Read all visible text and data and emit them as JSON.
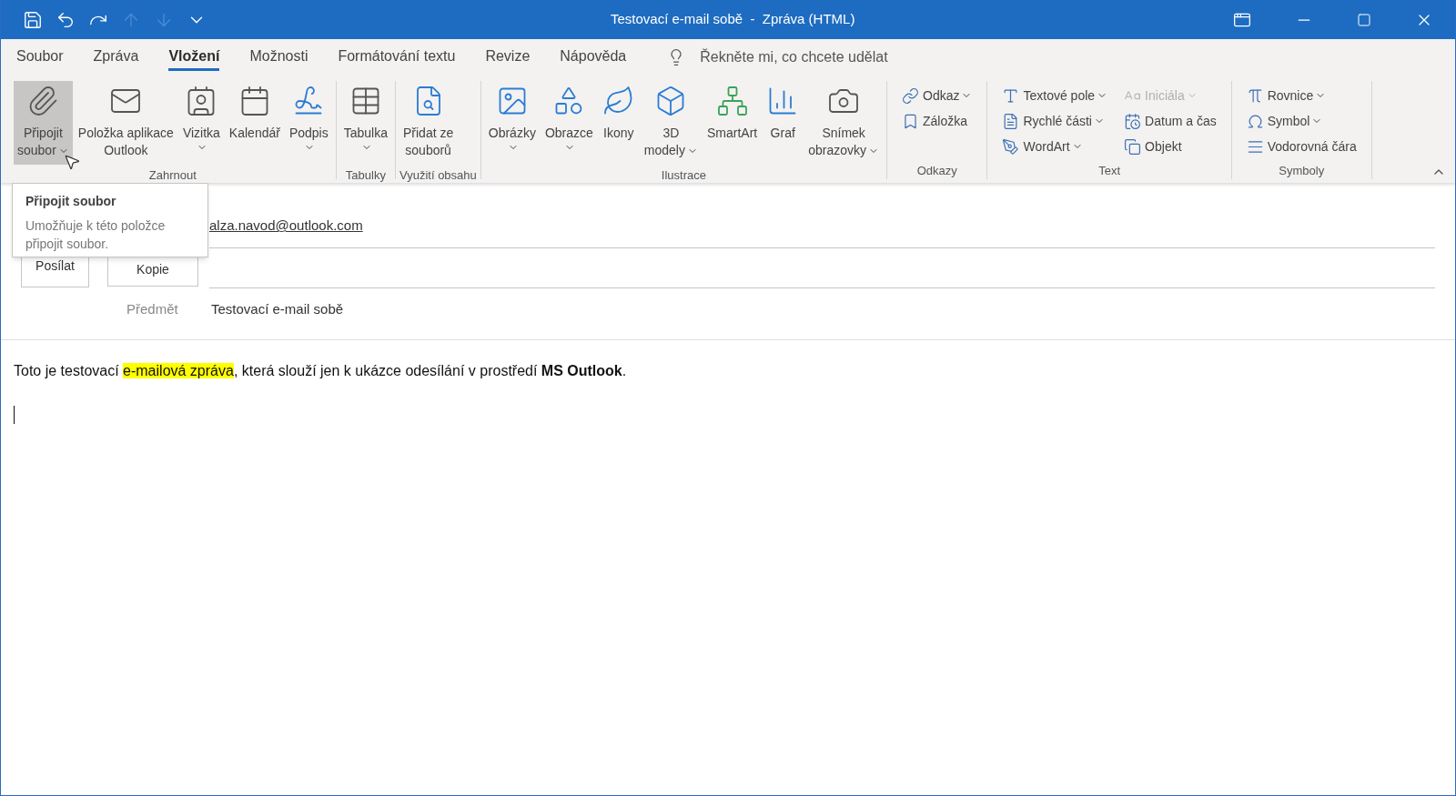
{
  "window": {
    "title": "Testovací e-mail sobě  -  Zpráva (HTML)"
  },
  "quick_access": [
    {
      "disabled": false
    },
    {
      "disabled": false
    },
    {
      "disabled": false
    },
    {
      "disabled": true
    },
    {
      "disabled": true
    },
    {
      "disabled": false
    }
  ],
  "tabs": [
    {
      "label": "Soubor",
      "selected": false
    },
    {
      "label": "Zpráva",
      "selected": false
    },
    {
      "label": "Vložení",
      "selected": true
    },
    {
      "label": "Možnosti",
      "selected": false
    },
    {
      "label": "Formátování textu",
      "selected": false
    },
    {
      "label": "Revize",
      "selected": false
    },
    {
      "label": "Nápověda",
      "selected": false
    }
  ],
  "tell_me": {
    "placeholder": "Řekněte mi, co chcete udělat"
  },
  "ribbon": {
    "groups": [
      {
        "label": "Zahrnout",
        "items": [
          {
            "kind": "large",
            "lines": [
              "Připojit",
              "soubor"
            ],
            "dropdown": true,
            "highlighted": true
          },
          {
            "kind": "large",
            "lines": [
              "Položka aplikace",
              "Outlook"
            ],
            "dropdown": false,
            "highlighted": false
          },
          {
            "kind": "large",
            "lines": [
              "Vizitka"
            ],
            "dropdown": true,
            "highlighted": false
          },
          {
            "kind": "large",
            "lines": [
              "Kalendář"
            ],
            "dropdown": false,
            "highlighted": false
          },
          {
            "kind": "large",
            "lines": [
              "Podpis"
            ],
            "dropdown": true,
            "highlighted": false
          }
        ]
      },
      {
        "label": "Tabulky",
        "items": [
          {
            "kind": "large",
            "lines": [
              "Tabulka"
            ],
            "dropdown": true,
            "highlighted": false
          }
        ]
      },
      {
        "label": "Využití obsahu",
        "items": [
          {
            "kind": "large",
            "lines": [
              "Přidat ze",
              "souborů"
            ],
            "dropdown": false,
            "highlighted": false
          }
        ]
      },
      {
        "label": "Ilustrace",
        "items": [
          {
            "kind": "large",
            "lines": [
              "Obrázky"
            ],
            "dropdown": true,
            "highlighted": false
          },
          {
            "kind": "large",
            "lines": [
              "Obrazce"
            ],
            "dropdown": true,
            "highlighted": false
          },
          {
            "kind": "large",
            "lines": [
              "Ikony"
            ],
            "dropdown": false,
            "highlighted": false
          },
          {
            "kind": "large",
            "lines": [
              "3D",
              "modely"
            ],
            "dropdown": true,
            "highlighted": false
          },
          {
            "kind": "large",
            "lines": [
              "SmartArt"
            ],
            "dropdown": false,
            "highlighted": false
          },
          {
            "kind": "large",
            "lines": [
              "Graf"
            ],
            "dropdown": false,
            "highlighted": false
          },
          {
            "kind": "large",
            "lines": [
              "Snímek",
              "obrazovky"
            ],
            "dropdown": true,
            "highlighted": false
          }
        ]
      },
      {
        "label": "Odkazy",
        "items": [
          {
            "kind": "small",
            "label": "Odkaz",
            "dropdown": true,
            "disabled": false
          },
          {
            "kind": "small",
            "label": "Záložka",
            "dropdown": false,
            "disabled": false
          }
        ]
      },
      {
        "label": "Text",
        "items": [
          {
            "kind": "small",
            "label": "Textové pole",
            "dropdown": true,
            "disabled": false
          },
          {
            "kind": "small",
            "label": "Rychlé části",
            "dropdown": true,
            "disabled": false
          },
          {
            "kind": "small",
            "label": "WordArt",
            "dropdown": true,
            "disabled": false
          },
          {
            "kind": "small",
            "label": "Iniciála",
            "dropdown": true,
            "disabled": true
          },
          {
            "kind": "small",
            "label": "Datum a čas",
            "dropdown": false,
            "disabled": false
          },
          {
            "kind": "small",
            "label": "Objekt",
            "dropdown": false,
            "disabled": false
          }
        ]
      },
      {
        "label": "Symboly",
        "items": [
          {
            "kind": "small",
            "label": "Rovnice",
            "dropdown": true,
            "disabled": false
          },
          {
            "kind": "small",
            "label": "Symbol",
            "dropdown": true,
            "disabled": false
          },
          {
            "kind": "small",
            "label": "Vodorovná čára",
            "dropdown": false,
            "disabled": false
          }
        ]
      }
    ]
  },
  "tooltip": {
    "title": "Připojit soubor",
    "text": "Umožňuje k této položce připojit soubor."
  },
  "message": {
    "send_button": "Posílat",
    "to": "alza.navod@outlook.com",
    "cc_button": "Kopie",
    "subject_label": "Předmět",
    "subject": "Testovací e-mail sobě",
    "body": [
      {
        "text": "Toto je testovací ",
        "highlight": false,
        "bold": false
      },
      {
        "text": "e-mailová zpráva",
        "highlight": true,
        "bold": false
      },
      {
        "text": ", která slouží jen k ukázce odesílání v prostředí ",
        "highlight": false,
        "bold": false
      },
      {
        "text": "MS Outlook",
        "highlight": false,
        "bold": true
      },
      {
        "text": ".",
        "highlight": false,
        "bold": false
      }
    ]
  }
}
